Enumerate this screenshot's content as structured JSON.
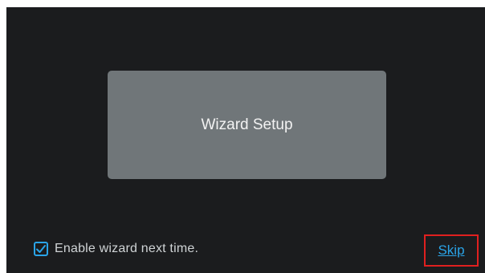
{
  "wizard": {
    "button_label": "Wizard Setup"
  },
  "options": {
    "enable_wizard_label": "Enable wizard next time.",
    "enable_wizard_checked": true
  },
  "actions": {
    "skip_label": "Skip"
  },
  "colors": {
    "background": "#1b1c1e",
    "button": "#707679",
    "accent": "#2aa4e8",
    "highlight_box": "#e0201f"
  },
  "icons": {
    "checkbox": "checkmark-icon"
  }
}
